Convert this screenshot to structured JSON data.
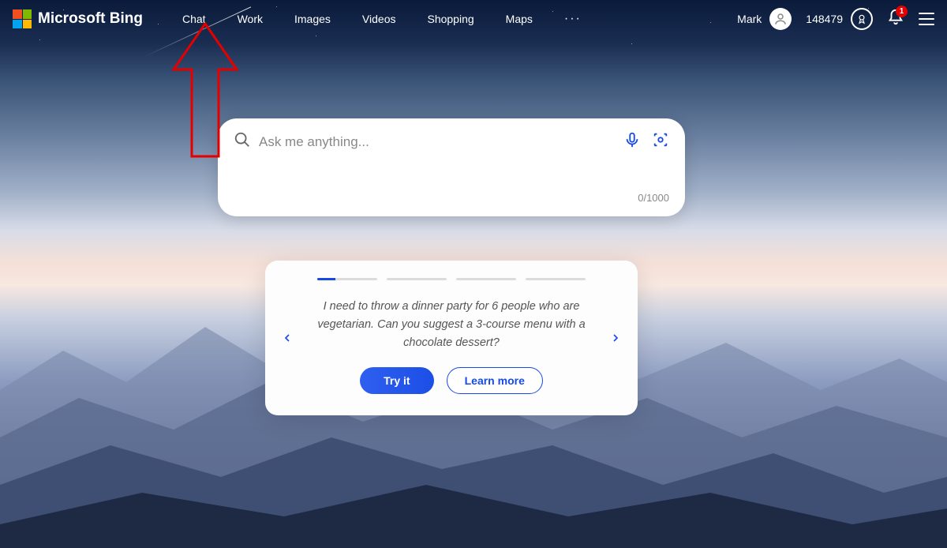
{
  "logo": {
    "text": "Microsoft Bing"
  },
  "nav": {
    "items": [
      "Chat",
      "Work",
      "Images",
      "Videos",
      "Shopping",
      "Maps"
    ]
  },
  "account": {
    "name": "Mark",
    "points": "148479",
    "notifications_count": "1"
  },
  "search": {
    "placeholder": "Ask me anything...",
    "counter": "0/1000"
  },
  "prompt_card": {
    "text": "I need to throw a dinner party for 6 people who are vegetarian. Can you suggest a 3-course menu with a chocolate dessert?",
    "try_label": "Try it",
    "learn_label": "Learn more",
    "segments": 4,
    "active_segment": 0
  }
}
